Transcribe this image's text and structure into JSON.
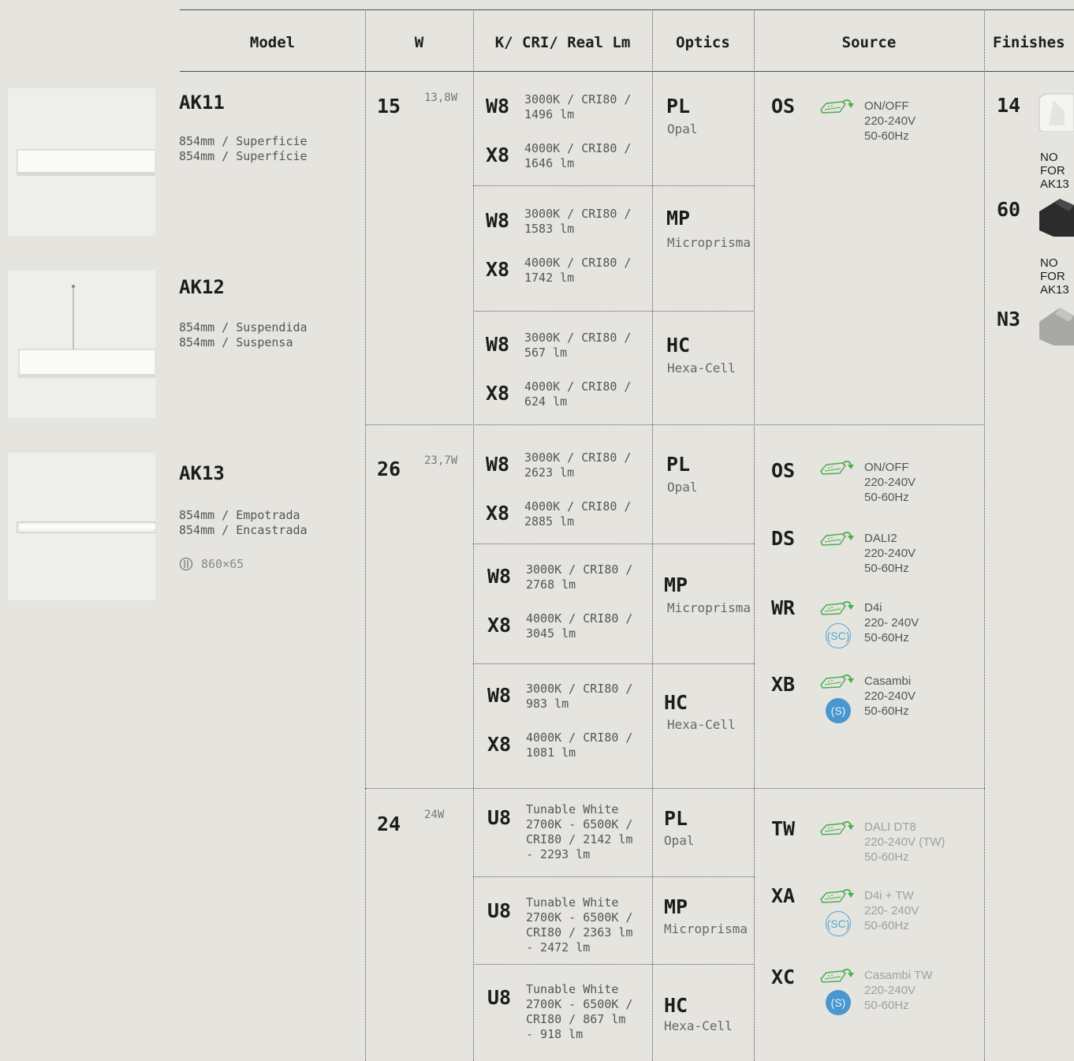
{
  "headers": {
    "model": "Model",
    "w": "W",
    "k": "K/ CRI/ Real Lm",
    "optics": "Optics",
    "source": "Source",
    "finishes": "Finishes"
  },
  "models": [
    {
      "name": "AK11",
      "desc": "854mm / Superficie\n854mm / Superfície"
    },
    {
      "name": "AK12",
      "desc": "854mm / Suspendida\n854mm / Suspensa"
    },
    {
      "name": "AK13",
      "desc": "854mm / Empotrada\n854mm / Encastrada",
      "cutout": "860×65"
    }
  ],
  "groups": [
    {
      "w": "15",
      "w_real": "13,8W",
      "rows": [
        {
          "opt_code": "PL",
          "opt_name": "Opal",
          "items": [
            {
              "code": "W8",
              "desc": "3000K / CRI80 /\n1496 lm"
            },
            {
              "code": "X8",
              "desc": "4000K / CRI80 /\n1646 lm"
            }
          ]
        },
        {
          "opt_code": "MP",
          "opt_name": "Microprisma",
          "items": [
            {
              "code": "W8",
              "desc": "3000K / CRI80 /\n1583 lm"
            },
            {
              "code": "X8",
              "desc": "4000K / CRI80 /\n1742 lm"
            }
          ]
        },
        {
          "opt_code": "HC",
          "opt_name": "Hexa-Cell",
          "items": [
            {
              "code": "W8",
              "desc": "3000K / CRI80 /\n567 lm"
            },
            {
              "code": "X8",
              "desc": "4000K / CRI80 /\n624 lm"
            }
          ]
        }
      ],
      "sources": [
        {
          "code": "OS",
          "desc": "ON/OFF\n220-240V\n50-60Hz"
        }
      ]
    },
    {
      "w": "26",
      "w_real": "23,7W",
      "rows": [
        {
          "opt_code": "PL",
          "opt_name": "Opal",
          "items": [
            {
              "code": "W8",
              "desc": "3000K / CRI80 /\n2623 lm"
            },
            {
              "code": "X8",
              "desc": "4000K / CRI80 /\n2885 lm"
            }
          ]
        },
        {
          "opt_code": "MP",
          "opt_name": "Microprisma",
          "items": [
            {
              "code": "W8",
              "desc": "3000K / CRI80 /\n2768 lm"
            },
            {
              "code": "X8",
              "desc": "4000K / CRI80 /\n3045 lm"
            }
          ]
        },
        {
          "opt_code": "HC",
          "opt_name": "Hexa-Cell",
          "items": [
            {
              "code": "W8",
              "desc": "3000K / CRI80 /\n983 lm"
            },
            {
              "code": "X8",
              "desc": "4000K / CRI80 /\n1081 lm"
            }
          ]
        }
      ],
      "sources": [
        {
          "code": "OS",
          "desc": "ON/OFF\n220-240V\n50-60Hz"
        },
        {
          "code": "DS",
          "desc": "DALI2\n220-240V\n50-60Hz"
        },
        {
          "code": "WR",
          "desc": "D4i\n220- 240V\n50-60Hz",
          "badge": "SC"
        },
        {
          "code": "XB",
          "desc": "Casambi\n220-240V\n50-60Hz",
          "badge": "S"
        }
      ]
    },
    {
      "w": "24",
      "w_real": "24W",
      "rows": [
        {
          "opt_code": "PL",
          "opt_name": "Opal",
          "items": [
            {
              "code": "U8",
              "desc": "Tunable White\n2700K - 6500K /\nCRI80 / 2142 lm\n- 2293 lm"
            }
          ]
        },
        {
          "opt_code": "MP",
          "opt_name": "Microprisma",
          "items": [
            {
              "code": "U8",
              "desc": "Tunable White\n2700K - 6500K /\nCRI80 / 2363 lm\n- 2472 lm"
            }
          ]
        },
        {
          "opt_code": "HC",
          "opt_name": "Hexa-Cell",
          "items": [
            {
              "code": "U8",
              "desc": "Tunable White\n2700K - 6500K /\nCRI80 / 867 lm\n- 918 lm"
            }
          ]
        }
      ],
      "sources": [
        {
          "code": "TW",
          "desc": "DALI DT8\n220-240V (TW)\n50-60Hz"
        },
        {
          "code": "XA",
          "desc": "D4i + TW\n220- 240V\n50-60Hz",
          "badge": "SC"
        },
        {
          "code": "XC",
          "desc": "Casambi TW\n220-240V\n50-60Hz",
          "badge": "S"
        }
      ]
    }
  ],
  "finishes": [
    {
      "code": "14",
      "note": "NO\nFOR\nAK13"
    },
    {
      "code": "60",
      "note": "NO\nFOR\nAK13"
    },
    {
      "code": "N3"
    }
  ],
  "colors": {
    "plug_green": "#4cae4c",
    "badge_blue": "#4a96cf"
  }
}
